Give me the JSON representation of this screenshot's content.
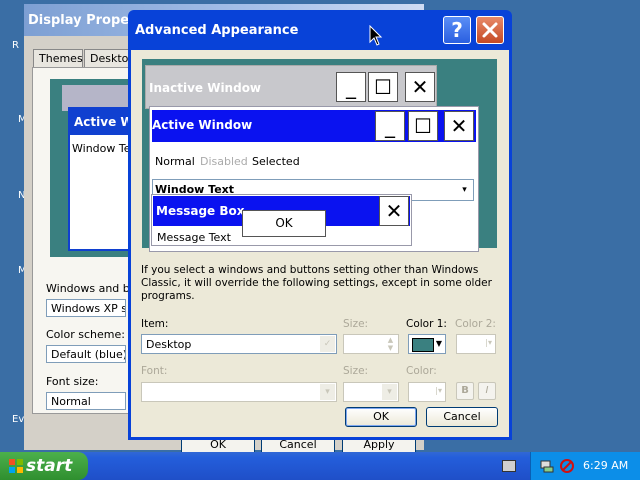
{
  "desktop": {
    "fragments": [
      "R",
      "M",
      "N",
      "M",
      "Ev"
    ]
  },
  "display_properties": {
    "title": "Display Properties",
    "tabs": [
      "Themes",
      "Desktop"
    ],
    "preview": {
      "active_title": "Active W",
      "window_text": "Window Te"
    },
    "windows_buttons_label": "Windows and bu",
    "windows_buttons_value": "Windows XP sty",
    "color_scheme_label": "Color scheme:",
    "color_scheme_value": "Default (blue)",
    "font_size_label": "Font size:",
    "font_size_value": "Normal",
    "buttons": {
      "ok": "OK",
      "cancel": "Cancel",
      "apply": "Apply"
    }
  },
  "advanced_appearance": {
    "title": "Advanced Appearance",
    "help_icon": "help-icon",
    "close_icon": "close-icon",
    "preview": {
      "inactive_title": "Inactive Window",
      "active_title": "Active Window",
      "states": {
        "normal": "Normal",
        "disabled": "Disabled",
        "selected": "Selected"
      },
      "window_text": "Window Text",
      "message_box_title": "Message Box",
      "message_text": "Message Text",
      "ok_label": "OK",
      "caption_glyphs": {
        "minimize": "_",
        "maximize": "☐",
        "close": "✕"
      }
    },
    "note": "If you select a windows and buttons setting other than Windows Classic, it will override the following settings, except in some older programs.",
    "item_label": "Item:",
    "item_value": "Desktop",
    "size_label": "Size:",
    "color1_label": "Color 1:",
    "color2_label": "Color 2:",
    "font_label": "Font:",
    "font_size_label": "Size:",
    "font_color_label": "Color:",
    "bold_label": "B",
    "italic_label": "I",
    "ok_button": "OK",
    "cancel_button": "Cancel",
    "color1_value": "#3a8080"
  },
  "taskbar": {
    "start_label": "start",
    "clock": "6:29 AM"
  },
  "colors": {
    "desktop": "#3a6ea5",
    "xp_title_blue": "#0842d8",
    "preview_active": "#0a12f0",
    "preview_background": "#3a8080",
    "start_green": "#3c9c3c"
  }
}
